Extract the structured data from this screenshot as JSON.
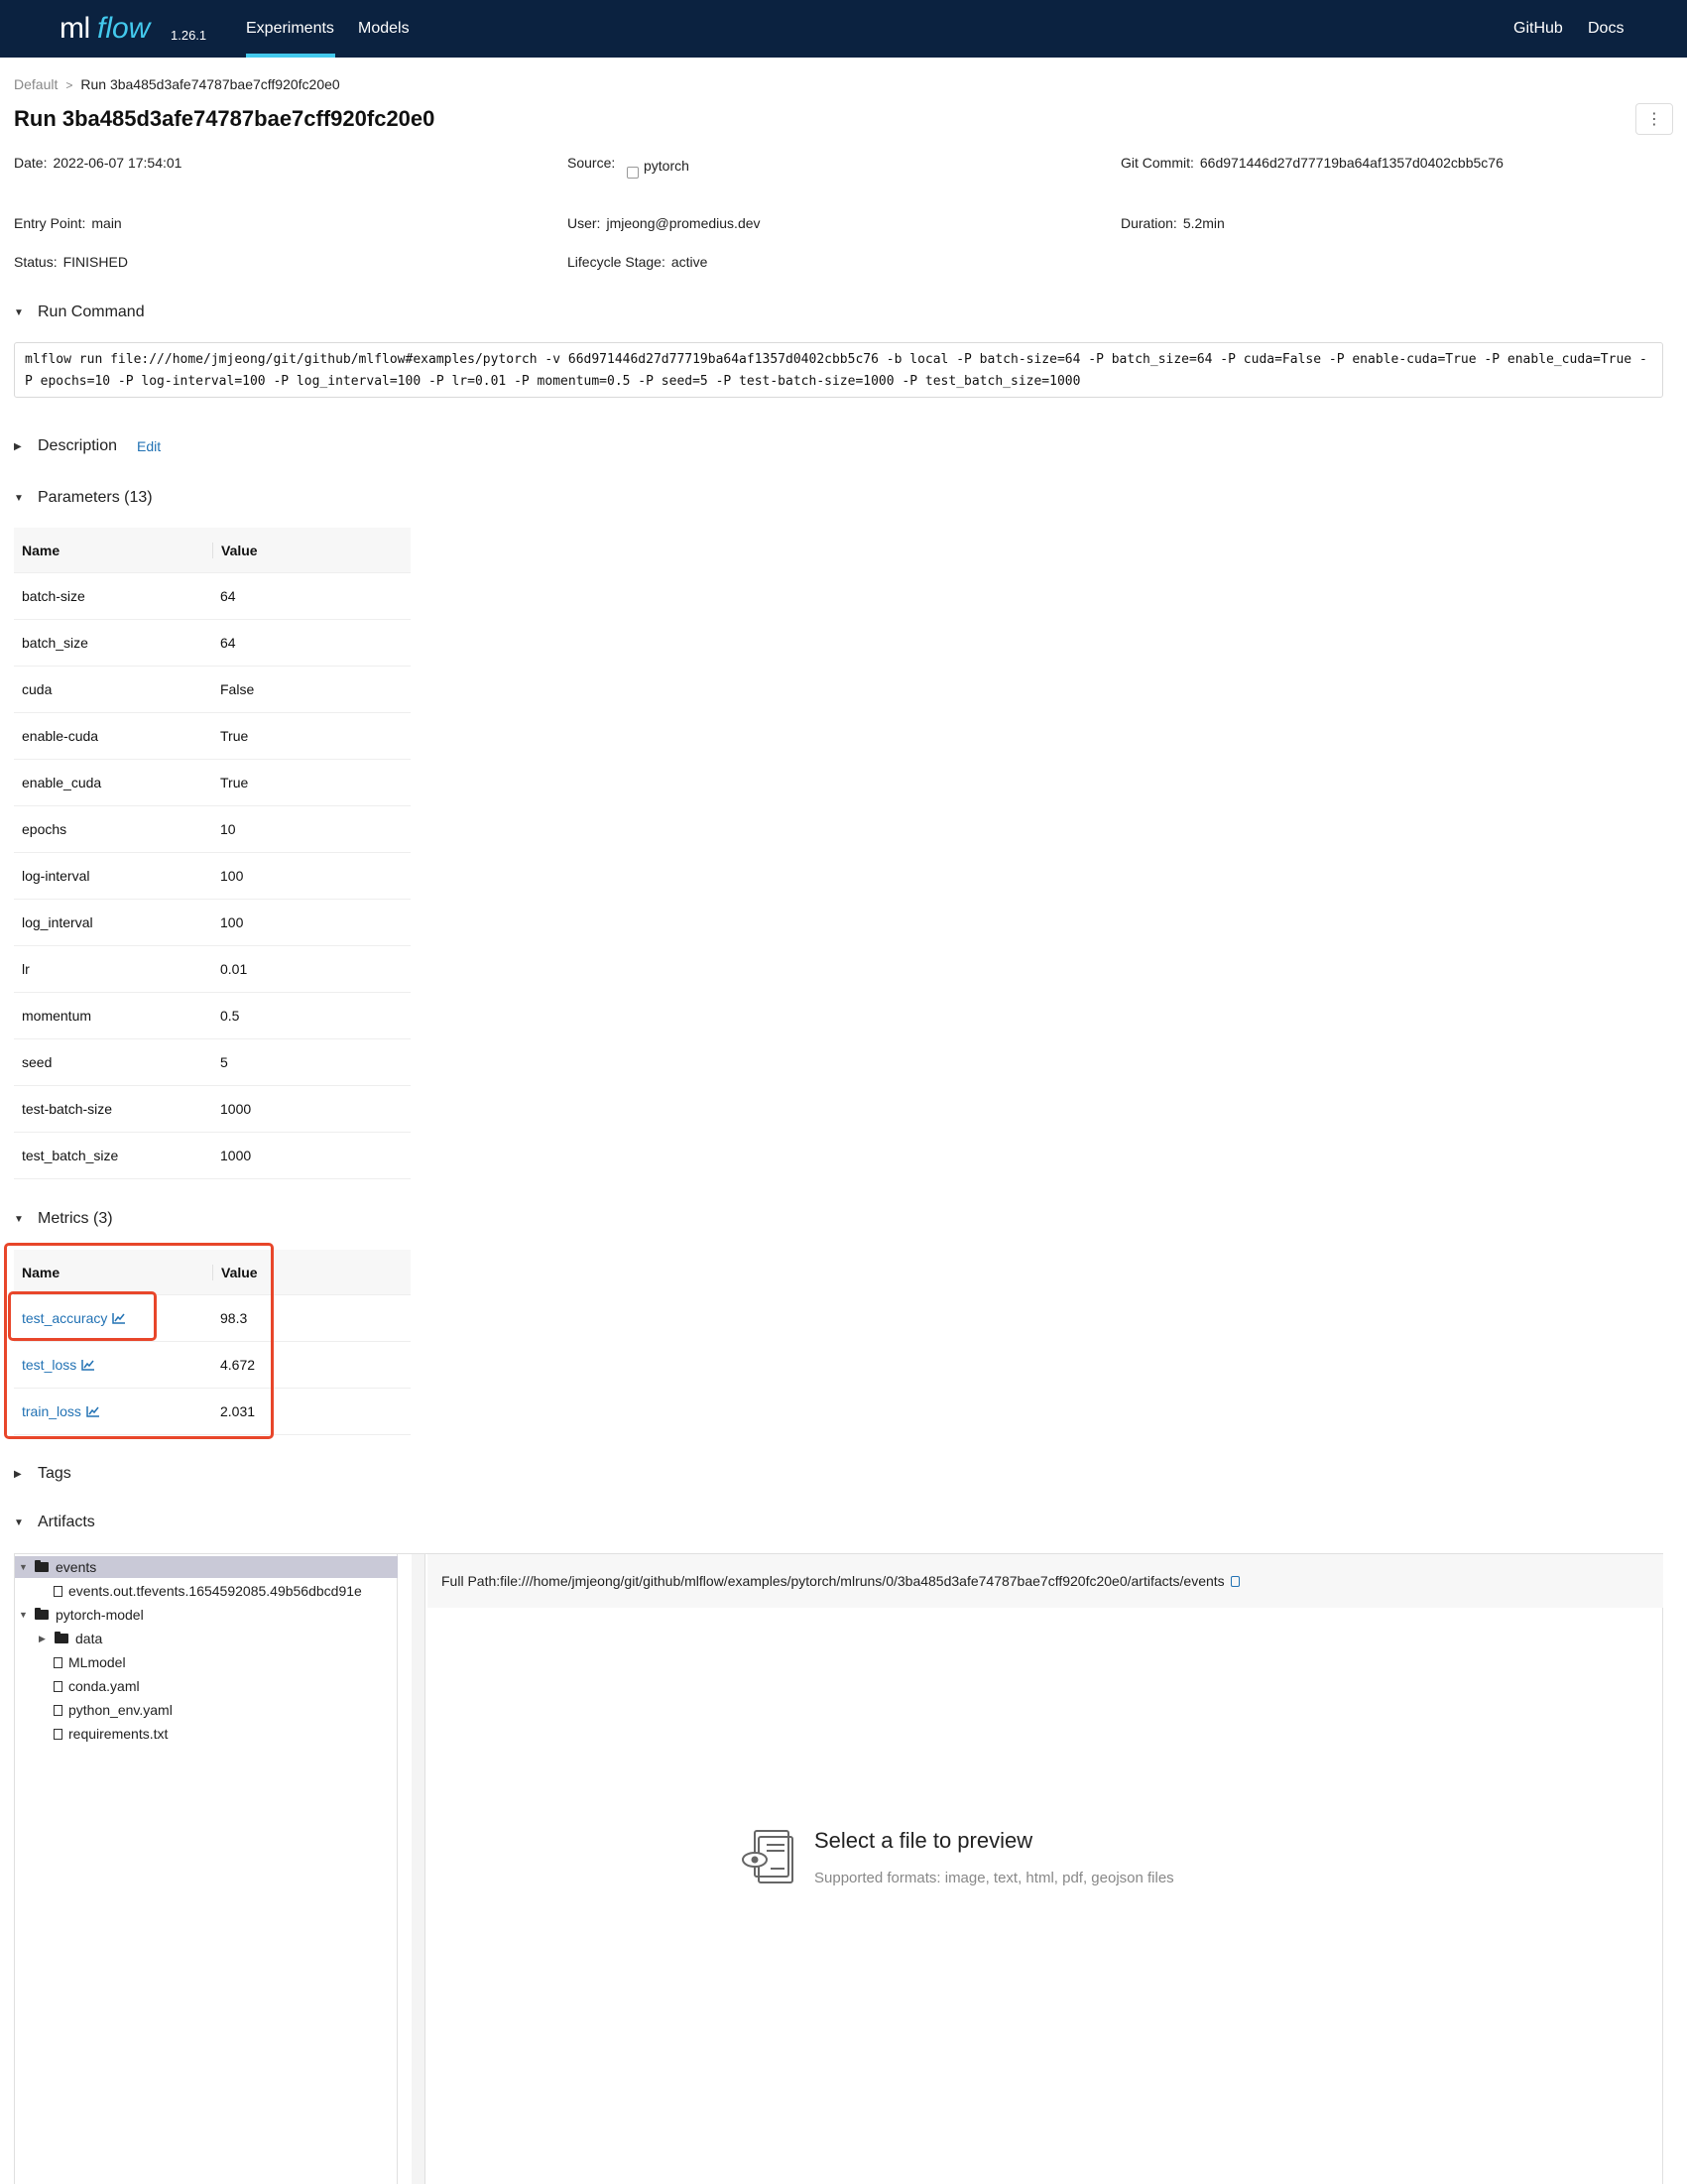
{
  "nav": {
    "logo_ml": "ml",
    "logo_flow": "flow",
    "version": "1.26.1",
    "experiments": "Experiments",
    "models": "Models",
    "github": "GitHub",
    "docs": "Docs"
  },
  "breadcrumb": {
    "root": "Default",
    "current": "Run 3ba485d3afe74787bae7cff920fc20e0"
  },
  "title": "Run 3ba485d3afe74787bae7cff920fc20e0",
  "kebab": "⋮",
  "meta": {
    "date_label": "Date:",
    "date_value": "2022-06-07 17:54:01",
    "source_label": "Source:",
    "source_value": "pytorch",
    "git_label": "Git Commit:",
    "git_value": "66d971446d27d77719ba64af1357d0402cbb5c76",
    "entry_label": "Entry Point:",
    "entry_value": "main",
    "user_label": "User:",
    "user_value": "jmjeong@promedius.dev",
    "duration_label": "Duration:",
    "duration_value": "5.2min",
    "status_label": "Status:",
    "status_value": "FINISHED",
    "lifecycle_label": "Lifecycle Stage:",
    "lifecycle_value": "active"
  },
  "sections": {
    "run_command": "Run Command",
    "description": "Description",
    "edit": "Edit",
    "parameters": "Parameters (13)",
    "metrics": "Metrics (3)",
    "tags": "Tags",
    "artifacts": "Artifacts"
  },
  "run_command": "mlflow run file:///home/jmjeong/git/github/mlflow#examples/pytorch -v 66d971446d27d77719ba64af1357d0402cbb5c76 -b local -P batch-size=64 -P batch_size=64 -P cuda=False -P enable-cuda=True -P enable_cuda=True -P epochs=10 -P log-interval=100 -P log_interval=100 -P lr=0.01 -P momentum=0.5 -P seed=5 -P test-batch-size=1000 -P test_batch_size=1000",
  "table_headers": {
    "name": "Name",
    "value": "Value"
  },
  "parameters": [
    {
      "name": "batch-size",
      "value": "64"
    },
    {
      "name": "batch_size",
      "value": "64"
    },
    {
      "name": "cuda",
      "value": "False"
    },
    {
      "name": "enable-cuda",
      "value": "True"
    },
    {
      "name": "enable_cuda",
      "value": "True"
    },
    {
      "name": "epochs",
      "value": "10"
    },
    {
      "name": "log-interval",
      "value": "100"
    },
    {
      "name": "log_interval",
      "value": "100"
    },
    {
      "name": "lr",
      "value": "0.01"
    },
    {
      "name": "momentum",
      "value": "0.5"
    },
    {
      "name": "seed",
      "value": "5"
    },
    {
      "name": "test-batch-size",
      "value": "1000"
    },
    {
      "name": "test_batch_size",
      "value": "1000"
    }
  ],
  "metrics": [
    {
      "name": "test_accuracy",
      "value": "98.3"
    },
    {
      "name": "test_loss",
      "value": "4.672"
    },
    {
      "name": "train_loss",
      "value": "2.031"
    }
  ],
  "artifacts": {
    "tree": [
      {
        "label": "events",
        "type": "folder",
        "depth": 0,
        "expanded": true,
        "selected": true
      },
      {
        "label": "events.out.tfevents.1654592085.49b56dbcd91e",
        "type": "file",
        "depth": 1
      },
      {
        "label": "pytorch-model",
        "type": "folder",
        "depth": 0,
        "expanded": true
      },
      {
        "label": "data",
        "type": "folder",
        "depth": 1,
        "expanded": false
      },
      {
        "label": "MLmodel",
        "type": "file",
        "depth": 1
      },
      {
        "label": "conda.yaml",
        "type": "file",
        "depth": 1
      },
      {
        "label": "python_env.yaml",
        "type": "file",
        "depth": 1
      },
      {
        "label": "requirements.txt",
        "type": "file",
        "depth": 1
      }
    ],
    "full_path": "Full Path:file:///home/jmjeong/git/github/mlflow/examples/pytorch/mlruns/0/3ba485d3afe74787bae7cff920fc20e0/artifacts/events",
    "preview_title": "Select a file to preview",
    "preview_subtitle": "Supported formats: image, text, html, pdf, geojson files"
  },
  "colors": {
    "nav_bg": "#0b2240",
    "accent": "#43c9ed",
    "link": "#2272b4",
    "highlight": "#e8462a"
  }
}
